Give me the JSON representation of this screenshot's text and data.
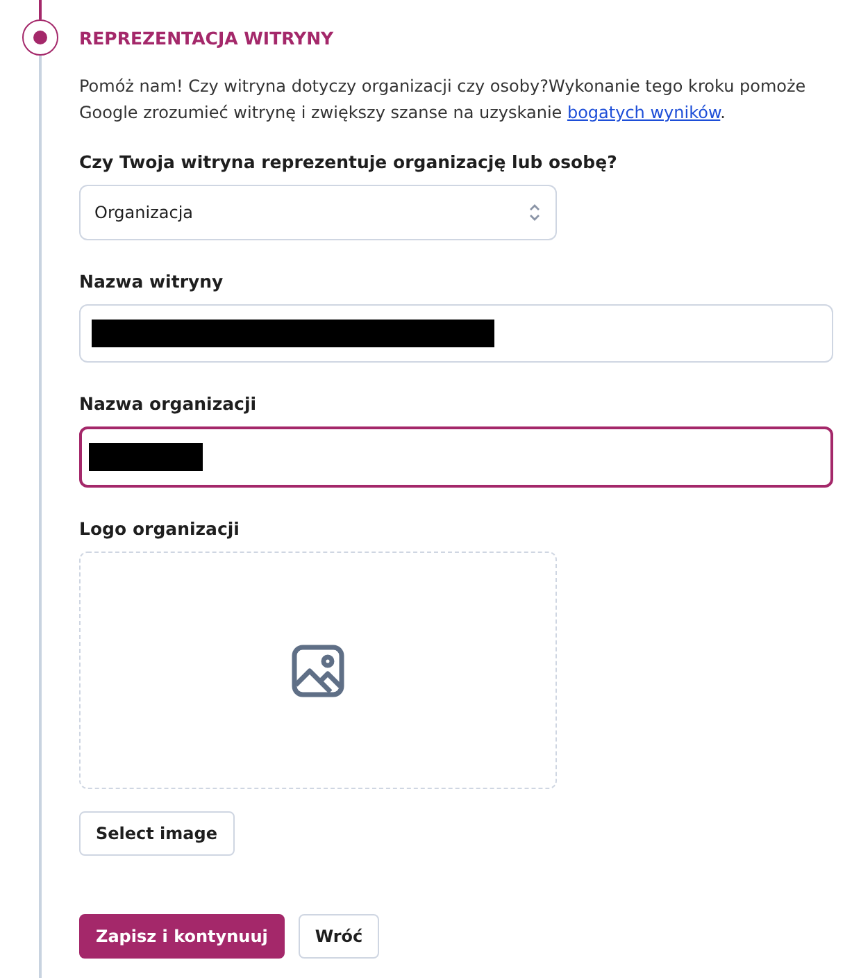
{
  "step": {
    "title": "REPREZENTACJA WITRYNY",
    "active": true
  },
  "intro": "Pomóż nam! Czy witryna dotyczy organizacji czy osoby?Wykonanie tego kroku pomoże Google zrozumieć witrynę i zwiększy szanse na uzyskanie ",
  "intro_link": "bogatych wyników",
  "intro_end": ".",
  "select": {
    "label": "Czy Twoja witryna reprezentuje organizację lub osobę?",
    "value": "Organizacja"
  },
  "fields": [
    {
      "label": "Nazwa witryny",
      "redacted": true,
      "focused": false
    },
    {
      "label": "Nazwa organizacji",
      "redacted": true,
      "focused": true
    }
  ],
  "logo": {
    "label": "Logo organizacji",
    "button": "Select image"
  },
  "buttons": [
    {
      "label": "Zapisz i kontynuuj",
      "kind": "primary"
    },
    {
      "label": "Wróć",
      "kind": "secondary"
    }
  ]
}
